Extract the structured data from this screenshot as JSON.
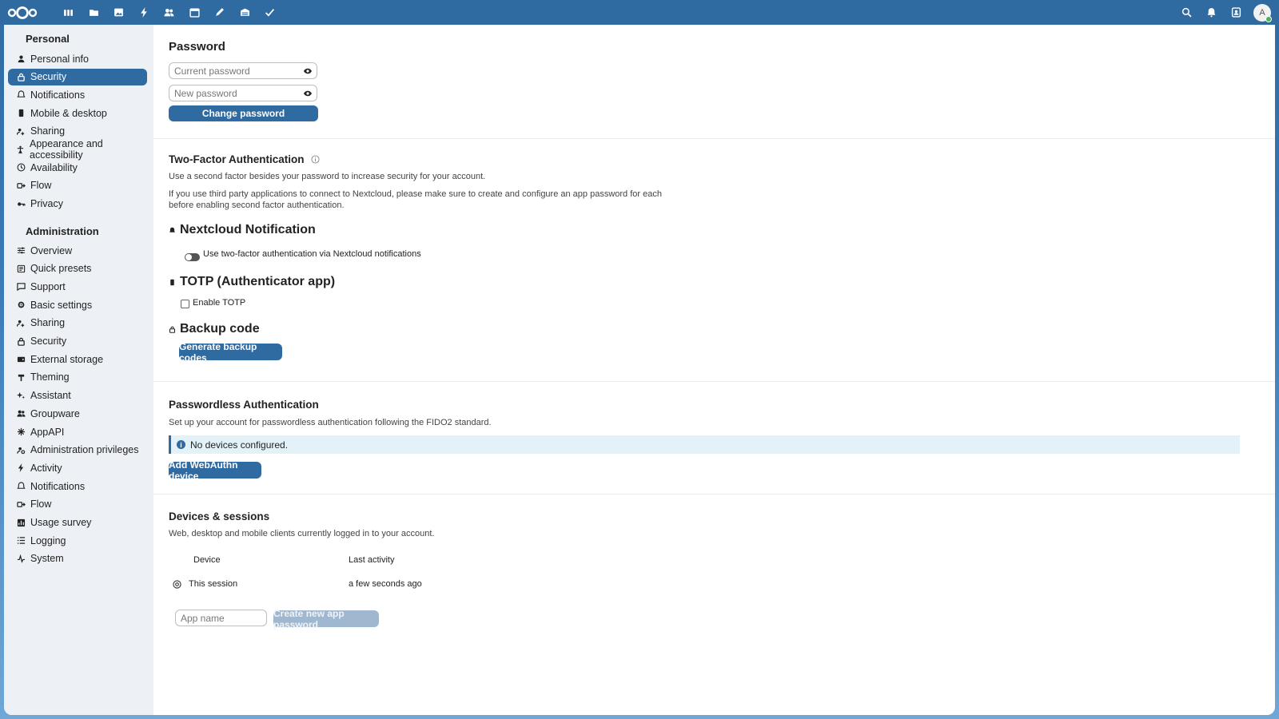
{
  "header": {
    "apps": [
      "dashboard-icon",
      "files-icon",
      "photos-icon",
      "activity-icon",
      "contacts-icon",
      "calendar-icon",
      "notes-icon",
      "deck-icon",
      "tasks-icon"
    ],
    "right": [
      "search-icon",
      "notifications-icon",
      "contacts-menu-icon"
    ],
    "avatar_letter": "A"
  },
  "sidebar": {
    "personal_title": "Personal",
    "personal_items": [
      {
        "label": "Personal info",
        "icon": "user-icon"
      },
      {
        "label": "Security",
        "icon": "lock-icon"
      },
      {
        "label": "Notifications",
        "icon": "bell-icon"
      },
      {
        "label": "Mobile & desktop",
        "icon": "phone-icon"
      },
      {
        "label": "Sharing",
        "icon": "share-icon"
      },
      {
        "label": "Appearance and accessibility",
        "icon": "accessibility-icon"
      },
      {
        "label": "Availability",
        "icon": "clock-icon"
      },
      {
        "label": "Flow",
        "icon": "flow-icon"
      },
      {
        "label": "Privacy",
        "icon": "key-icon"
      }
    ],
    "admin_title": "Administration",
    "admin_items": [
      {
        "label": "Overview",
        "icon": "sliders-icon"
      },
      {
        "label": "Quick presets",
        "icon": "presets-icon"
      },
      {
        "label": "Support",
        "icon": "chat-icon"
      },
      {
        "label": "Basic settings",
        "icon": "gear-icon"
      },
      {
        "label": "Sharing",
        "icon": "share-icon"
      },
      {
        "label": "Security",
        "icon": "lock-icon"
      },
      {
        "label": "External storage",
        "icon": "storage-icon"
      },
      {
        "label": "Theming",
        "icon": "brush-icon"
      },
      {
        "label": "Assistant",
        "icon": "sparkle-icon"
      },
      {
        "label": "Groupware",
        "icon": "group-icon"
      },
      {
        "label": "AppAPI",
        "icon": "api-icon"
      },
      {
        "label": "Administration privileges",
        "icon": "admin-icon"
      },
      {
        "label": "Activity",
        "icon": "bolt-icon"
      },
      {
        "label": "Notifications",
        "icon": "bell-icon"
      },
      {
        "label": "Flow",
        "icon": "flow-icon"
      },
      {
        "label": "Usage survey",
        "icon": "chart-icon"
      },
      {
        "label": "Logging",
        "icon": "list-icon"
      },
      {
        "label": "System",
        "icon": "pulse-icon"
      }
    ]
  },
  "password": {
    "title": "Password",
    "current_placeholder": "Current password",
    "new_placeholder": "New password",
    "change_button": "Change password"
  },
  "twofactor": {
    "title": "Two-Factor Authentication",
    "desc1": "Use a second factor besides your password to increase security for your account.",
    "desc2a": "If you use third party applications to connect to Nextcloud, please make sure to create and configure an app password for each",
    "desc2b": "before enabling second factor authentication.",
    "nc_title": "Nextcloud Notification",
    "nc_toggle_label": "Use two-factor authentication via Nextcloud notifications",
    "totp_title": "TOTP (Authenticator app)",
    "totp_checkbox_label": "Enable TOTP",
    "backup_title": "Backup code",
    "backup_button": "Generate backup codes"
  },
  "passwordless": {
    "title": "Passwordless Authentication",
    "desc": "Set up your account for passwordless authentication following the FIDO2 standard.",
    "info": "No devices configured.",
    "button": "Add WebAuthn device"
  },
  "devices": {
    "title": "Devices & sessions",
    "desc": "Web, desktop and mobile clients currently logged in to your account.",
    "col_device": "Device",
    "col_activity": "Last activity",
    "row_device": "This session",
    "row_activity": "a few seconds ago",
    "app_name_placeholder": "App name",
    "create_button": "Create new app password"
  }
}
